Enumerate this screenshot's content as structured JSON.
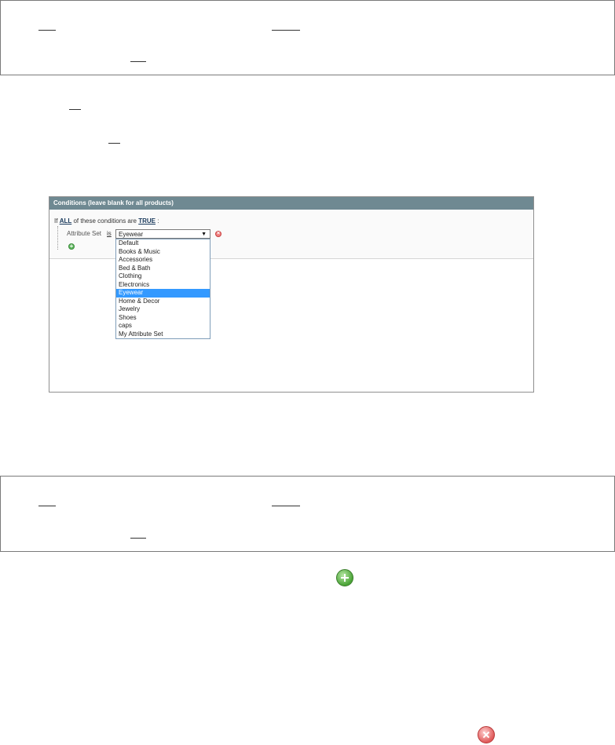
{
  "panel": {
    "header": "Conditions (leave blank for all products)",
    "rule_prefix": "If",
    "aggregator": "ALL",
    "rule_middle": "of these conditions are",
    "value": "TRUE",
    "rule_suffix": ":",
    "condition": {
      "attribute_label": "Attribute Set",
      "operator": "is",
      "selected": "Eyewear",
      "arrow": "▼"
    },
    "options": [
      "Default",
      "Books & Music",
      "Accessories",
      "Bed & Bath",
      "Clothing",
      "Electronics",
      "Eyewear",
      "Home & Decor",
      "Jewelry",
      "Shoes",
      "caps",
      "My Attribute Set"
    ],
    "selected_index": 6,
    "icons": {
      "remove": "remove-condition-icon",
      "add": "add-condition-icon"
    }
  },
  "standalone_icons": {
    "add": "add-icon",
    "remove": "remove-icon"
  }
}
